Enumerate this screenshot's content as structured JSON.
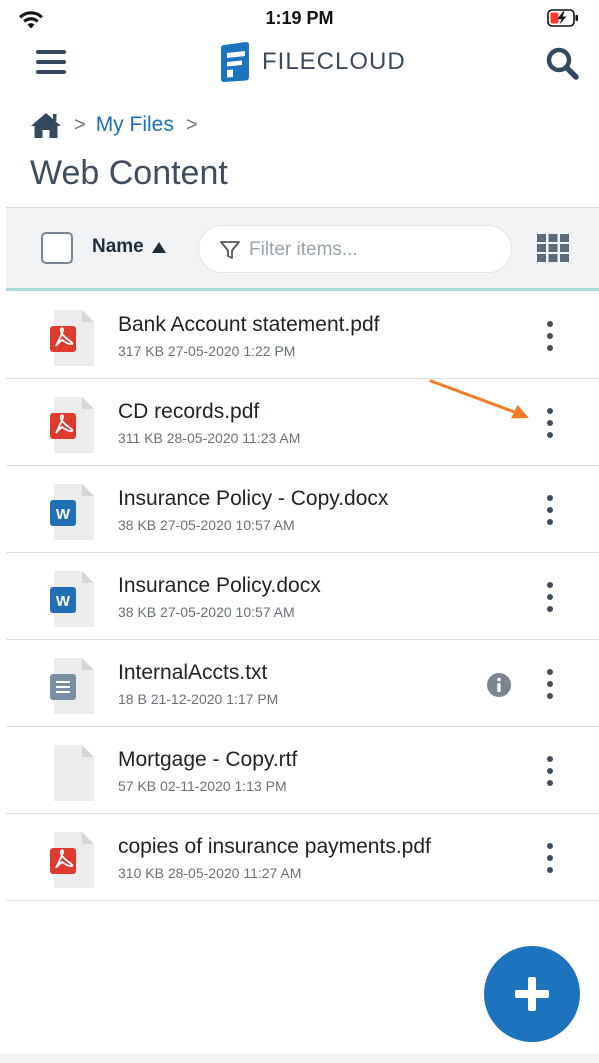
{
  "status_bar": {
    "time": "1:19 PM"
  },
  "header": {
    "logo_text": "FILECLOUD"
  },
  "breadcrumb": {
    "current": "My Files"
  },
  "page": {
    "title": "Web Content"
  },
  "toolbar": {
    "sort_label": "Name",
    "sort_direction": "ascending",
    "filter_placeholder": "Filter items...",
    "filter_value": ""
  },
  "files": [
    {
      "name": "Bank Account statement.pdf",
      "meta": "317 KB 27-05-2020 1:22 PM",
      "type": "pdf",
      "icon": "pdf-file-icon"
    },
    {
      "name": "CD records.pdf",
      "meta": "311 KB 28-05-2020 11:23 AM",
      "type": "pdf",
      "icon": "pdf-file-icon"
    },
    {
      "name": "Insurance Policy - Copy.docx",
      "meta": "38 KB 27-05-2020 10:57 AM",
      "type": "docx",
      "icon": "word-file-icon"
    },
    {
      "name": "Insurance Policy.docx",
      "meta": "38 KB 27-05-2020 10:57 AM",
      "type": "docx",
      "icon": "word-file-icon"
    },
    {
      "name": "InternalAccts.txt",
      "meta": "18 B 21-12-2020 1:17 PM",
      "type": "txt",
      "icon": "text-file-icon",
      "has_info": true
    },
    {
      "name": "Mortgage - Copy.rtf",
      "meta": "57 KB 02-11-2020 1:13 PM",
      "type": "rtf",
      "icon": "blank-file-icon"
    },
    {
      "name": "copies of insurance payments.pdf",
      "meta": "310 KB 28-05-2020 11:27 AM",
      "type": "pdf",
      "icon": "pdf-file-icon"
    }
  ],
  "colors": {
    "brand_blue": "#1e73be",
    "link_blue": "#1f6fb5",
    "pdf_red": "#e03a2f",
    "word_blue": "#1f6fb5",
    "annotation_orange": "#f07c2a",
    "toolbar_accent": "#a8dcd6"
  }
}
